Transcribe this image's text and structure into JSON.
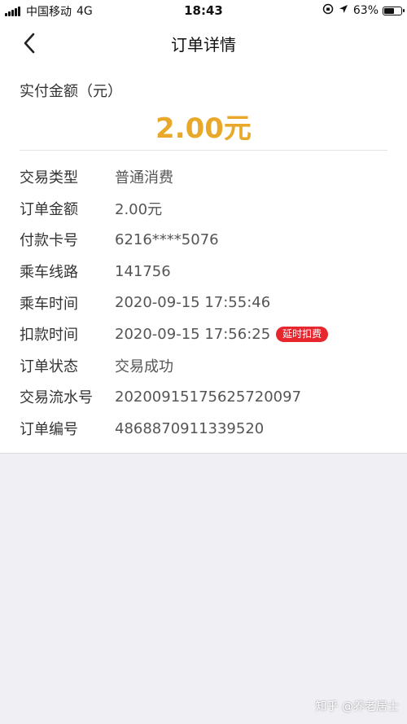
{
  "status_bar": {
    "carrier": "中国移动",
    "network": "4G",
    "time": "18:43",
    "battery": "63%",
    "battery_level": 0.63
  },
  "nav": {
    "title": "订单详情",
    "back_icon": "chevron-left-icon"
  },
  "summary": {
    "amount_label": "实付金额（元）",
    "amount_value": "2.00元",
    "accent_color": "#e8a92b"
  },
  "details": [
    {
      "label": "交易类型",
      "value": "普通消费"
    },
    {
      "label": "订单金额",
      "value": "2.00元"
    },
    {
      "label": "付款卡号",
      "value": "6216****5076"
    },
    {
      "label": "乘车线路",
      "value": "141756"
    },
    {
      "label": "乘车时间",
      "value": "2020-09-15 17:55:46"
    },
    {
      "label": "扣款时间",
      "value": "2020-09-15 17:56:25",
      "tag": "延时扣费"
    },
    {
      "label": "订单状态",
      "value": "交易成功"
    },
    {
      "label": "交易流水号",
      "value": "20200915175625720097"
    },
    {
      "label": "订单编号",
      "value": "4868870911339520"
    }
  ],
  "tag_color": "#e8262d",
  "watermark": "知乎 @养老居士"
}
